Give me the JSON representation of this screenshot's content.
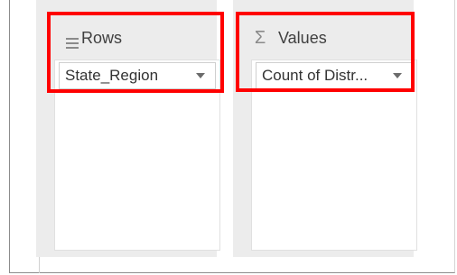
{
  "rows_area": {
    "title": "Rows",
    "icon": "rows-lines-icon",
    "field": {
      "label": "State_Region",
      "dropdown_icon": "dropdown-caret-icon"
    }
  },
  "values_area": {
    "title": "Values",
    "icon": "sigma-icon",
    "field": {
      "label": "Count of Distr...",
      "dropdown_icon": "dropdown-caret-icon"
    }
  },
  "highlight_color": "#ff0000"
}
